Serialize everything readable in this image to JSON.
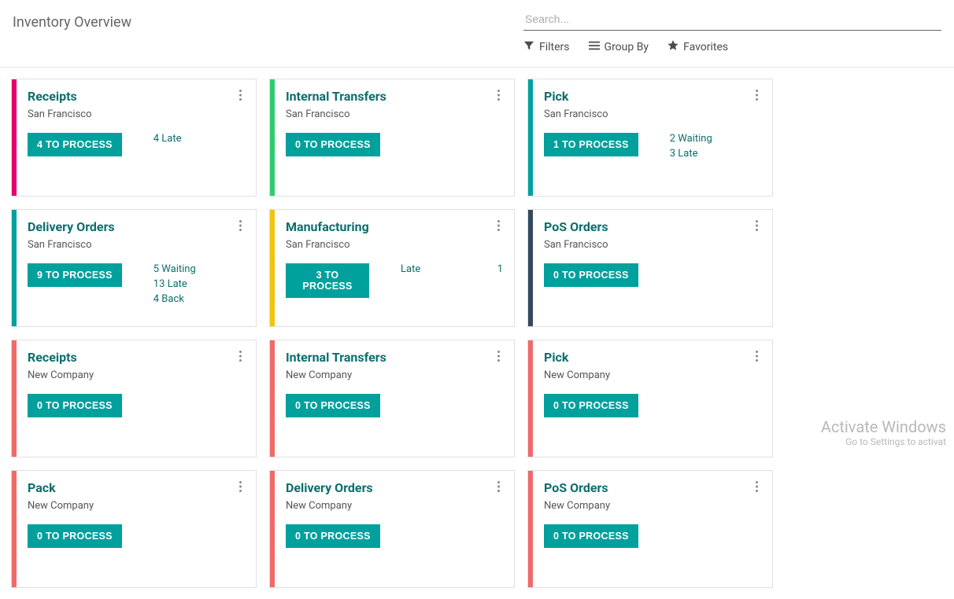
{
  "page": {
    "title": "Inventory Overview"
  },
  "search": {
    "placeholder": "Search..."
  },
  "toolbar": {
    "filters": "Filters",
    "group_by": "Group By",
    "favorites": "Favorites"
  },
  "colors": {
    "pink": "#e6006b",
    "green": "#2ecc71",
    "teal": "#00a09d",
    "yellow": "#f1c40f",
    "navy": "#34495e",
    "salmon": "#f06a6a"
  },
  "watermark": {
    "line1": "Activate Windows",
    "line2": "Go to Settings to activat"
  },
  "cards": [
    {
      "title": "Receipts",
      "subtitle": "San Francisco",
      "stripe": "pink",
      "btn": "4 TO PROCESS",
      "status": [
        {
          "label": "4 Late"
        }
      ]
    },
    {
      "title": "Internal Transfers",
      "subtitle": "San Francisco",
      "stripe": "green",
      "btn": "0 TO PROCESS",
      "status": []
    },
    {
      "title": "Pick",
      "subtitle": "San Francisco",
      "stripe": "teal",
      "btn": "1 TO PROCESS",
      "status": [
        {
          "label": "2 Waiting"
        },
        {
          "label": "3 Late"
        }
      ]
    },
    {
      "title": "Delivery Orders",
      "subtitle": "San Francisco",
      "stripe": "teal",
      "btn": "9 TO PROCESS",
      "status": [
        {
          "label": "5 Waiting"
        },
        {
          "label": "13 Late"
        },
        {
          "label": "4 Back"
        }
      ]
    },
    {
      "title": "Manufacturing",
      "subtitle": "San Francisco",
      "stripe": "yellow",
      "btn": "3 TO PROCESS",
      "status": [
        {
          "label": "Late",
          "count": "1",
          "split": true
        }
      ]
    },
    {
      "title": "PoS Orders",
      "subtitle": "San Francisco",
      "stripe": "navy",
      "btn": "0 TO PROCESS",
      "status": []
    },
    {
      "title": "Receipts",
      "subtitle": "New Company",
      "stripe": "salmon",
      "btn": "0 TO PROCESS",
      "status": []
    },
    {
      "title": "Internal Transfers",
      "subtitle": "New Company",
      "stripe": "salmon",
      "btn": "0 TO PROCESS",
      "status": []
    },
    {
      "title": "Pick",
      "subtitle": "New Company",
      "stripe": "salmon",
      "btn": "0 TO PROCESS",
      "status": []
    },
    {
      "title": "Pack",
      "subtitle": "New Company",
      "stripe": "salmon",
      "btn": "0 TO PROCESS",
      "status": []
    },
    {
      "title": "Delivery Orders",
      "subtitle": "New Company",
      "stripe": "salmon",
      "btn": "0 TO PROCESS",
      "status": []
    },
    {
      "title": "PoS Orders",
      "subtitle": "New Company",
      "stripe": "salmon",
      "btn": "0 TO PROCESS",
      "status": []
    }
  ]
}
